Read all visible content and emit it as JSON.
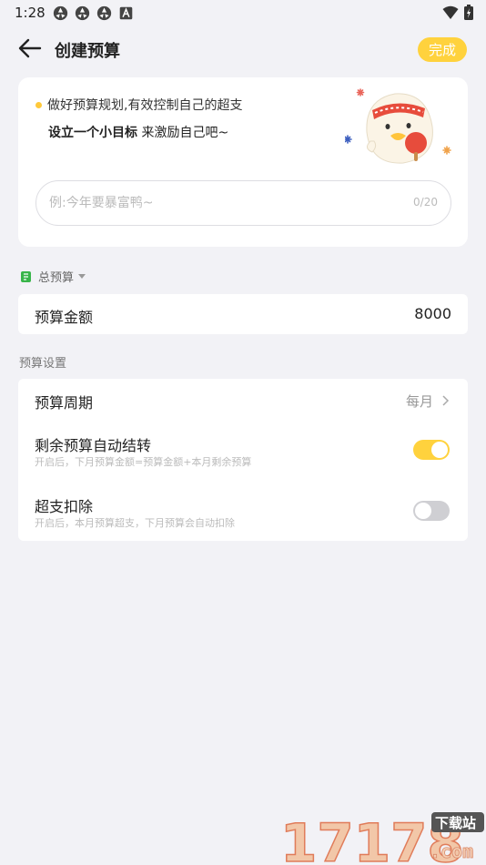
{
  "status_bar": {
    "time": "1:28",
    "icons": [
      "app-notification-icon",
      "app-notification-icon",
      "app-notification-icon",
      "accessibility-icon"
    ],
    "right_icons": [
      "wifi-icon",
      "battery-icon"
    ]
  },
  "header": {
    "title": "创建预算",
    "done_label": "完成",
    "accent_color": "#ffd23d"
  },
  "goal_card": {
    "tip": "做好预算规划,有效控制自己的超支",
    "goal_strong": "设立一个小目标",
    "goal_rest": " 来激励自己吧~",
    "input": {
      "placeholder": "例:今年要暴富鸭~",
      "value": "",
      "counter": "0/20"
    }
  },
  "total_budget": {
    "label": "总预算"
  },
  "amount": {
    "label": "预算金额",
    "value": "8000"
  },
  "settings": {
    "section_label": "预算设置",
    "period": {
      "label": "预算周期",
      "value": "每月"
    },
    "carryover": {
      "label": "剩余预算自动结转",
      "desc": "开启后，下月预算金额=预算金额+本月剩余预算",
      "enabled": true
    },
    "overspend": {
      "label": "超支扣除",
      "desc": "开启后，本月预算超支，下月预算会自动扣除",
      "enabled": false
    }
  },
  "watermark": {
    "number": "17178",
    "tag": "下载站",
    "domain": ".com"
  }
}
